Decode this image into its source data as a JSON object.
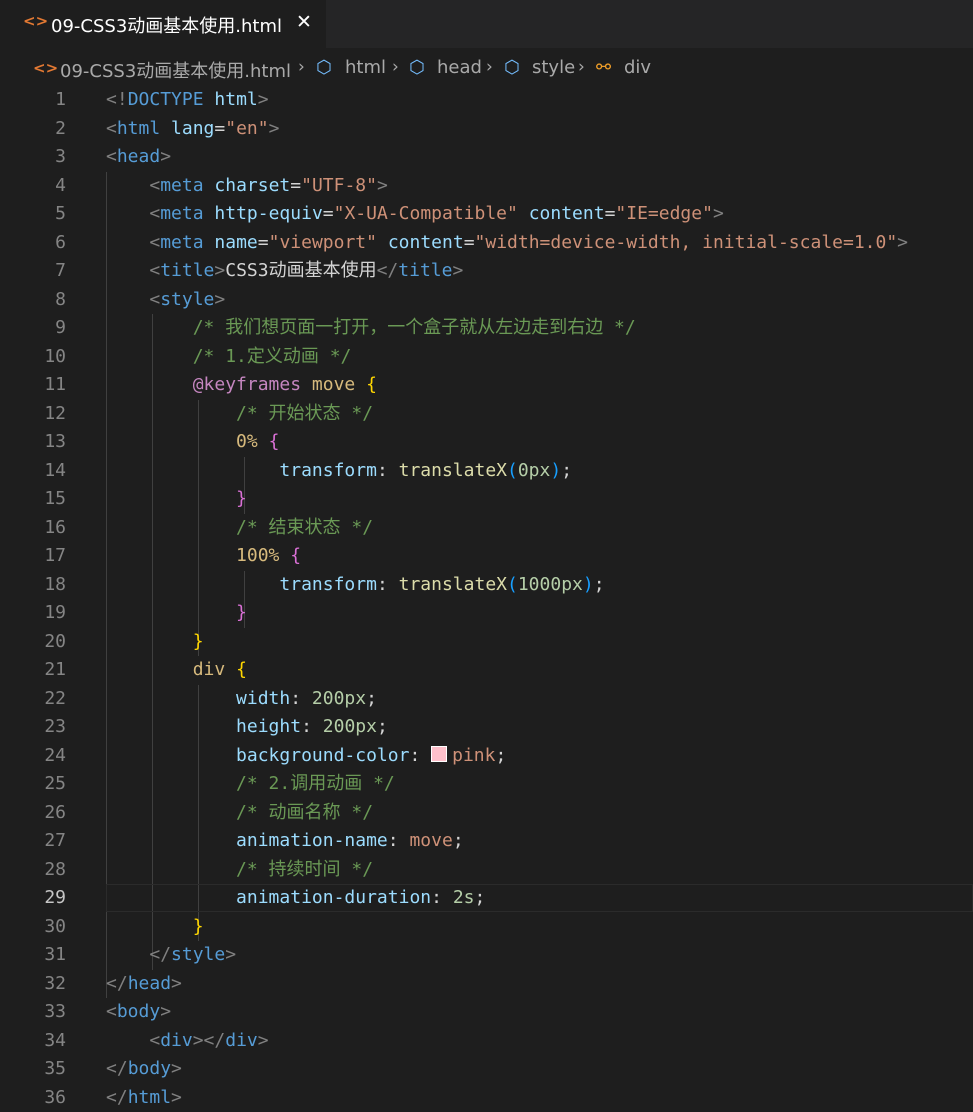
{
  "tab": {
    "icon": "<>",
    "title": "09-CSS3动画基本使用.html",
    "close": "✕"
  },
  "breadcrumb": {
    "file": "09-CSS3动画基本使用.html",
    "items": [
      "html",
      "head",
      "style",
      "div"
    ],
    "separator": "›"
  },
  "lines": [
    {
      "n": "1",
      "parts": [
        [
          "tag",
          "<!"
        ],
        [
          "name",
          "DOCTYPE"
        ],
        [
          "text",
          " "
        ],
        [
          "attr",
          "html"
        ],
        [
          "tag",
          ">"
        ]
      ]
    },
    {
      "n": "2",
      "parts": [
        [
          "tag",
          "<"
        ],
        [
          "name",
          "html"
        ],
        [
          "text",
          " "
        ],
        [
          "attr",
          "lang"
        ],
        [
          "text",
          "="
        ],
        [
          "str",
          "\"en\""
        ],
        [
          "tag",
          ">"
        ]
      ]
    },
    {
      "n": "3",
      "parts": [
        [
          "tag",
          "<"
        ],
        [
          "name",
          "head"
        ],
        [
          "tag",
          ">"
        ]
      ]
    },
    {
      "n": "4",
      "parts": [
        [
          "text",
          "    "
        ],
        [
          "tag",
          "<"
        ],
        [
          "name",
          "meta"
        ],
        [
          "text",
          " "
        ],
        [
          "attr",
          "charset"
        ],
        [
          "text",
          "="
        ],
        [
          "str",
          "\"UTF-8\""
        ],
        [
          "tag",
          ">"
        ]
      ]
    },
    {
      "n": "5",
      "parts": [
        [
          "text",
          "    "
        ],
        [
          "tag",
          "<"
        ],
        [
          "name",
          "meta"
        ],
        [
          "text",
          " "
        ],
        [
          "attr",
          "http-equiv"
        ],
        [
          "text",
          "="
        ],
        [
          "str",
          "\"X-UA-Compatible\""
        ],
        [
          "text",
          " "
        ],
        [
          "attr",
          "content"
        ],
        [
          "text",
          "="
        ],
        [
          "str",
          "\"IE=edge\""
        ],
        [
          "tag",
          ">"
        ]
      ]
    },
    {
      "n": "6",
      "parts": [
        [
          "text",
          "    "
        ],
        [
          "tag",
          "<"
        ],
        [
          "name",
          "meta"
        ],
        [
          "text",
          " "
        ],
        [
          "attr",
          "name"
        ],
        [
          "text",
          "="
        ],
        [
          "str",
          "\"viewport\""
        ],
        [
          "text",
          " "
        ],
        [
          "attr",
          "content"
        ],
        [
          "text",
          "="
        ],
        [
          "str",
          "\"width=device-width, initial-scale=1.0\""
        ],
        [
          "tag",
          ">"
        ]
      ]
    },
    {
      "n": "7",
      "parts": [
        [
          "text",
          "    "
        ],
        [
          "tag",
          "<"
        ],
        [
          "name",
          "title"
        ],
        [
          "tag",
          ">"
        ],
        [
          "text",
          "CSS3动画基本使用"
        ],
        [
          "tag",
          "</"
        ],
        [
          "name",
          "title"
        ],
        [
          "tag",
          ">"
        ]
      ]
    },
    {
      "n": "8",
      "parts": [
        [
          "text",
          "    "
        ],
        [
          "tag",
          "<"
        ],
        [
          "name",
          "style"
        ],
        [
          "tag",
          ">"
        ]
      ]
    },
    {
      "n": "9",
      "parts": [
        [
          "text",
          "        "
        ],
        [
          "com",
          "/* 我们想页面一打开，一个盒子就从左边走到右边 */"
        ]
      ]
    },
    {
      "n": "10",
      "parts": [
        [
          "text",
          "        "
        ],
        [
          "com",
          "/* 1.定义动画 */"
        ]
      ]
    },
    {
      "n": "11",
      "parts": [
        [
          "text",
          "        "
        ],
        [
          "at",
          "@keyframes"
        ],
        [
          "text",
          " "
        ],
        [
          "kfn",
          "move"
        ],
        [
          "text",
          " "
        ],
        [
          "b1",
          "{"
        ]
      ]
    },
    {
      "n": "12",
      "parts": [
        [
          "text",
          "            "
        ],
        [
          "com",
          "/* 开始状态 */"
        ]
      ]
    },
    {
      "n": "13",
      "parts": [
        [
          "text",
          "            "
        ],
        [
          "kfn",
          "0%"
        ],
        [
          "text",
          " "
        ],
        [
          "b2",
          "{"
        ]
      ]
    },
    {
      "n": "14",
      "parts": [
        [
          "text",
          "                "
        ],
        [
          "prop",
          "transform"
        ],
        [
          "punc",
          ": "
        ],
        [
          "fn",
          "translateX"
        ],
        [
          "b3",
          "("
        ],
        [
          "num",
          "0px"
        ],
        [
          "b3",
          ")"
        ],
        [
          "punc",
          ";"
        ]
      ]
    },
    {
      "n": "15",
      "parts": [
        [
          "text",
          "            "
        ],
        [
          "b2",
          "}"
        ]
      ]
    },
    {
      "n": "16",
      "parts": [
        [
          "text",
          "            "
        ],
        [
          "com",
          "/* 结束状态 */"
        ]
      ]
    },
    {
      "n": "17",
      "parts": [
        [
          "text",
          "            "
        ],
        [
          "kfn",
          "100%"
        ],
        [
          "text",
          " "
        ],
        [
          "b2",
          "{"
        ]
      ]
    },
    {
      "n": "18",
      "parts": [
        [
          "text",
          "                "
        ],
        [
          "prop",
          "transform"
        ],
        [
          "punc",
          ": "
        ],
        [
          "fn",
          "translateX"
        ],
        [
          "b3",
          "("
        ],
        [
          "num",
          "1000px"
        ],
        [
          "b3",
          ")"
        ],
        [
          "punc",
          ";"
        ]
      ]
    },
    {
      "n": "19",
      "parts": [
        [
          "text",
          "            "
        ],
        [
          "b2",
          "}"
        ]
      ]
    },
    {
      "n": "20",
      "parts": [
        [
          "text",
          "        "
        ],
        [
          "b1",
          "}"
        ]
      ]
    },
    {
      "n": "21",
      "parts": [
        [
          "text",
          "        "
        ],
        [
          "kfn",
          "div"
        ],
        [
          "text",
          " "
        ],
        [
          "b1",
          "{"
        ]
      ]
    },
    {
      "n": "22",
      "parts": [
        [
          "text",
          "            "
        ],
        [
          "prop",
          "width"
        ],
        [
          "punc",
          ": "
        ],
        [
          "num",
          "200px"
        ],
        [
          "punc",
          ";"
        ]
      ]
    },
    {
      "n": "23",
      "parts": [
        [
          "text",
          "            "
        ],
        [
          "prop",
          "height"
        ],
        [
          "punc",
          ": "
        ],
        [
          "num",
          "200px"
        ],
        [
          "punc",
          ";"
        ]
      ]
    },
    {
      "n": "24",
      "parts": [
        [
          "text",
          "            "
        ],
        [
          "prop",
          "background-color"
        ],
        [
          "punc",
          ": "
        ],
        [
          "swatch",
          ""
        ],
        [
          "val",
          "pink"
        ],
        [
          "punc",
          ";"
        ]
      ]
    },
    {
      "n": "25",
      "parts": [
        [
          "text",
          "            "
        ],
        [
          "com",
          "/* 2.调用动画 */"
        ]
      ]
    },
    {
      "n": "26",
      "parts": [
        [
          "text",
          "            "
        ],
        [
          "com",
          "/* 动画名称 */"
        ]
      ]
    },
    {
      "n": "27",
      "parts": [
        [
          "text",
          "            "
        ],
        [
          "prop",
          "animation-name"
        ],
        [
          "punc",
          ": "
        ],
        [
          "val",
          "move"
        ],
        [
          "punc",
          ";"
        ]
      ]
    },
    {
      "n": "28",
      "parts": [
        [
          "text",
          "            "
        ],
        [
          "com",
          "/* 持续时间 */"
        ]
      ]
    },
    {
      "n": "29",
      "parts": [
        [
          "text",
          "            "
        ],
        [
          "prop",
          "animation-duration"
        ],
        [
          "punc",
          ": "
        ],
        [
          "num",
          "2s"
        ],
        [
          "punc",
          ";"
        ]
      ]
    },
    {
      "n": "30",
      "parts": [
        [
          "text",
          "        "
        ],
        [
          "b1",
          "}"
        ]
      ]
    },
    {
      "n": "31",
      "parts": [
        [
          "text",
          "    "
        ],
        [
          "tag",
          "</"
        ],
        [
          "name",
          "style"
        ],
        [
          "tag",
          ">"
        ]
      ]
    },
    {
      "n": "32",
      "parts": [
        [
          "tag",
          "</"
        ],
        [
          "name",
          "head"
        ],
        [
          "tag",
          ">"
        ]
      ]
    },
    {
      "n": "33",
      "parts": [
        [
          "tag",
          "<"
        ],
        [
          "name",
          "body"
        ],
        [
          "tag",
          ">"
        ]
      ]
    },
    {
      "n": "34",
      "parts": [
        [
          "text",
          "    "
        ],
        [
          "tag",
          "<"
        ],
        [
          "name",
          "div"
        ],
        [
          "tag",
          "></"
        ],
        [
          "name",
          "div"
        ],
        [
          "tag",
          ">"
        ]
      ]
    },
    {
      "n": "35",
      "parts": [
        [
          "tag",
          "</"
        ],
        [
          "name",
          "body"
        ],
        [
          "tag",
          ">"
        ]
      ]
    },
    {
      "n": "36",
      "parts": [
        [
          "tag",
          "</"
        ],
        [
          "name",
          "html"
        ],
        [
          "tag",
          ">"
        ]
      ]
    }
  ],
  "active_line": "29",
  "colors": {
    "background": "#1e1e1e",
    "tab_bar": "#252526",
    "swatch_pink": "#ffc0cb"
  }
}
